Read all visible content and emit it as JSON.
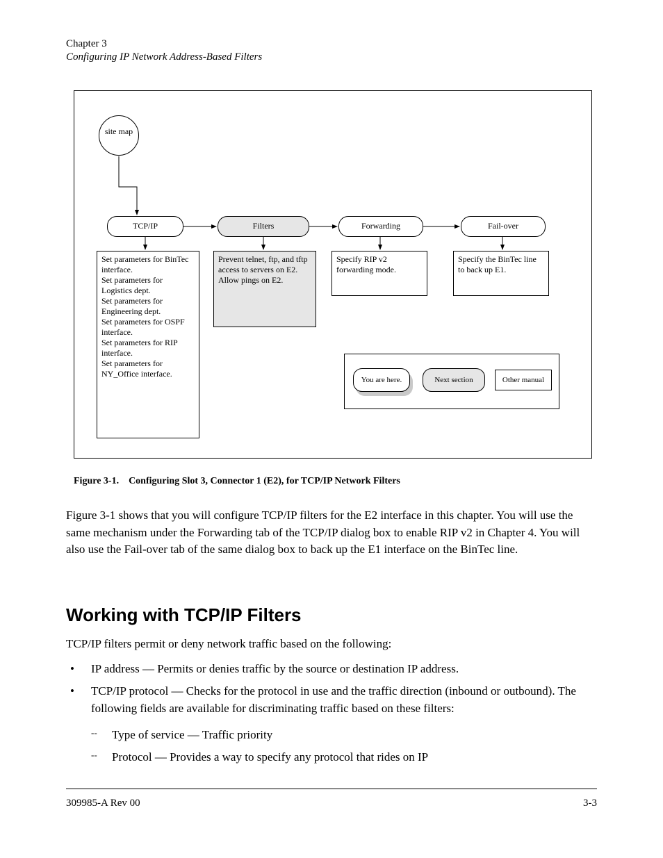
{
  "header": {
    "chapter_label": "Chapter 3",
    "chapter_title": "Configuring IP Network Address-Based Filters"
  },
  "diagram": {
    "start": "site\nmap",
    "nodes": {
      "tcpip": "TCP/IP",
      "filters": "Filters",
      "forwarding": "Forwarding",
      "failover": "Fail-over"
    },
    "desc": {
      "tcpip": "Set parameters for BinTec interface.\nSet parameters for Logistics dept.\nSet parameters for Engineering dept.\nSet parameters for OSPF interface.\nSet parameters for RIP interface.\nSet parameters for NY_Office interface.",
      "filters": "Prevent telnet, ftp, and tftp access to servers on E2.\nAllow pings on E2.",
      "forwarding": "Specify RIP v2 forwarding mode.",
      "failover": "Specify the BinTec line to back up E1."
    },
    "legend": {
      "you_are_here": "You are\nhere.",
      "next_section": "Next section",
      "other_manual": "Other manual"
    }
  },
  "figure_caption": "Figure 3-1. Configuring Slot 3, Connector 1 (E2), for TCP/IP Network Filters",
  "paragraph": "Figure 3-1 shows that you will configure TCP/IP filters for the E2 interface in this chapter. You will use the same mechanism under the Forwarding tab of the TCP/IP dialog box to enable RIP v2 in Chapter 4. You will also use the Fail-over tab of the same dialog box to back up the E1 interface on the BinTec line.",
  "section": {
    "heading": "Working with TCP/IP Filters",
    "intro": "TCP/IP filters permit or deny network traffic based on the following:",
    "items": [
      "IP address — Permits or denies traffic by the source or destination IP address.",
      "TCP/IP protocol — Checks for the protocol in use and the traffic direction (inbound or outbound). The following fields are available for discriminating traffic based on these filters:"
    ],
    "sublist": [
      "Type of service — Traffic priority",
      "Protocol — Provides a way to specify any protocol that rides on IP"
    ]
  },
  "footer": {
    "left": "309985-A Rev 00",
    "right": "3-3"
  }
}
